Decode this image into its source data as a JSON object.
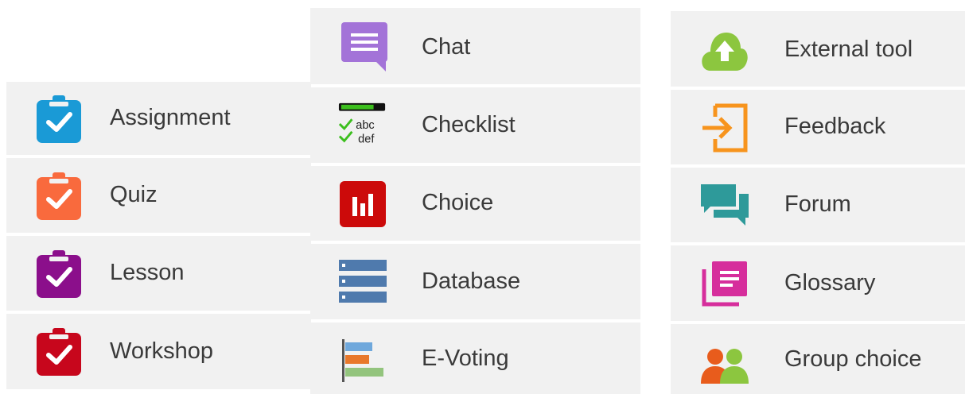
{
  "columns": [
    {
      "items": [
        {
          "label": "Assignment",
          "icon": "assignment-icon",
          "color": "#1a9ad6"
        },
        {
          "label": "Quiz",
          "icon": "quiz-icon",
          "color": "#f96a3d"
        },
        {
          "label": "Lesson",
          "icon": "lesson-icon",
          "color": "#8b0f8b"
        },
        {
          "label": "Workshop",
          "icon": "workshop-icon",
          "color": "#c7061c"
        }
      ]
    },
    {
      "items": [
        {
          "label": "Chat",
          "icon": "chat-icon",
          "color": "#a373d8"
        },
        {
          "label": "Checklist",
          "icon": "checklist-icon",
          "color": "#3cbf1e"
        },
        {
          "label": "Choice",
          "icon": "choice-icon",
          "color": "#cc0a0a"
        },
        {
          "label": "Database",
          "icon": "database-icon",
          "color": "#4f7aad"
        },
        {
          "label": "E-Voting",
          "icon": "evoting-icon",
          "color": "#e8782b"
        }
      ]
    },
    {
      "items": [
        {
          "label": "External tool",
          "icon": "external-tool-icon",
          "color": "#8cc63f"
        },
        {
          "label": "Feedback",
          "icon": "feedback-icon",
          "color": "#f7941d"
        },
        {
          "label": "Forum",
          "icon": "forum-icon",
          "color": "#2e9a9a"
        },
        {
          "label": "Glossary",
          "icon": "glossary-icon",
          "color": "#d62e9c"
        },
        {
          "label": "Group choice",
          "icon": "group-choice-icon",
          "color": "#e85c1c"
        }
      ]
    }
  ],
  "checklist_icon_text": {
    "line1": "abc",
    "line2": "def"
  }
}
